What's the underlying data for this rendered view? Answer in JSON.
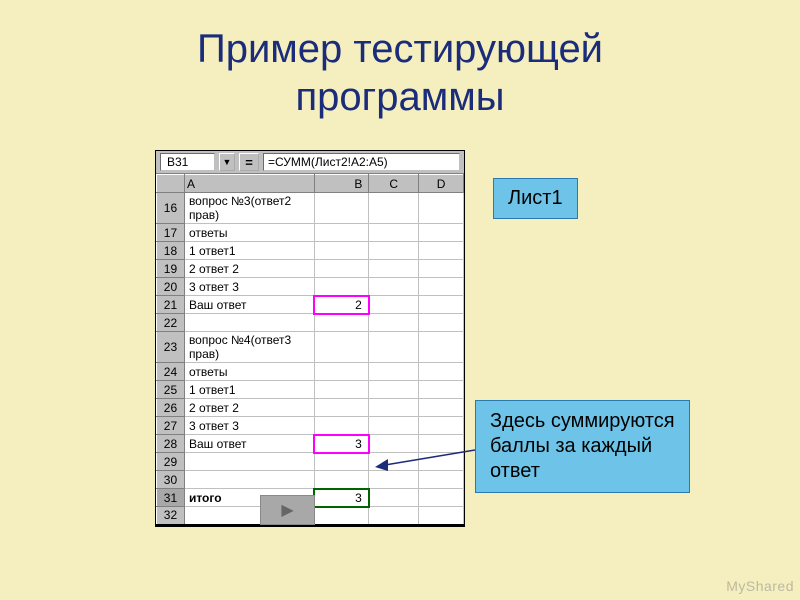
{
  "title_line1": "Пример тестирующей",
  "title_line2": "программы",
  "excel": {
    "name_box": "B31",
    "formula": "=СУММ(Лист2!A2:A5)",
    "columns": [
      "A",
      "B",
      "C",
      "D"
    ],
    "rows": [
      {
        "n": 16,
        "a": "вопрос №3(ответ2 прав)",
        "b": "",
        "pink": false,
        "green": false
      },
      {
        "n": 17,
        "a": "ответы",
        "b": "",
        "pink": false,
        "green": false
      },
      {
        "n": 18,
        "a": "1 ответ1",
        "b": "",
        "pink": false,
        "green": false
      },
      {
        "n": 19,
        "a": "2 ответ 2",
        "b": "",
        "pink": false,
        "green": false
      },
      {
        "n": 20,
        "a": "3 ответ 3",
        "b": "",
        "pink": false,
        "green": false
      },
      {
        "n": 21,
        "a": "Ваш ответ",
        "b": "2",
        "pink": true,
        "green": false
      },
      {
        "n": 22,
        "a": "",
        "b": "",
        "pink": false,
        "green": false
      },
      {
        "n": 23,
        "a": "вопрос №4(ответ3 прав)",
        "b": "",
        "pink": false,
        "green": false
      },
      {
        "n": 24,
        "a": "ответы",
        "b": "",
        "pink": false,
        "green": false
      },
      {
        "n": 25,
        "a": "1 ответ1",
        "b": "",
        "pink": false,
        "green": false
      },
      {
        "n": 26,
        "a": "2 ответ 2",
        "b": "",
        "pink": false,
        "green": false
      },
      {
        "n": 27,
        "a": "3 ответ 3",
        "b": "",
        "pink": false,
        "green": false
      },
      {
        "n": 28,
        "a": "Ваш ответ",
        "b": "3",
        "pink": true,
        "green": false
      },
      {
        "n": 29,
        "a": "",
        "b": "",
        "pink": false,
        "green": false
      },
      {
        "n": 30,
        "a": "",
        "b": "",
        "pink": false,
        "green": false
      },
      {
        "n": 31,
        "a": "итого",
        "b": "3",
        "pink": false,
        "green": true
      },
      {
        "n": 32,
        "a": "",
        "b": "",
        "pink": false,
        "green": false
      }
    ]
  },
  "callouts": {
    "sheet": "Лист1",
    "sum": "Здесь суммируются баллы за каждый ответ"
  },
  "watermark": "MyShared"
}
